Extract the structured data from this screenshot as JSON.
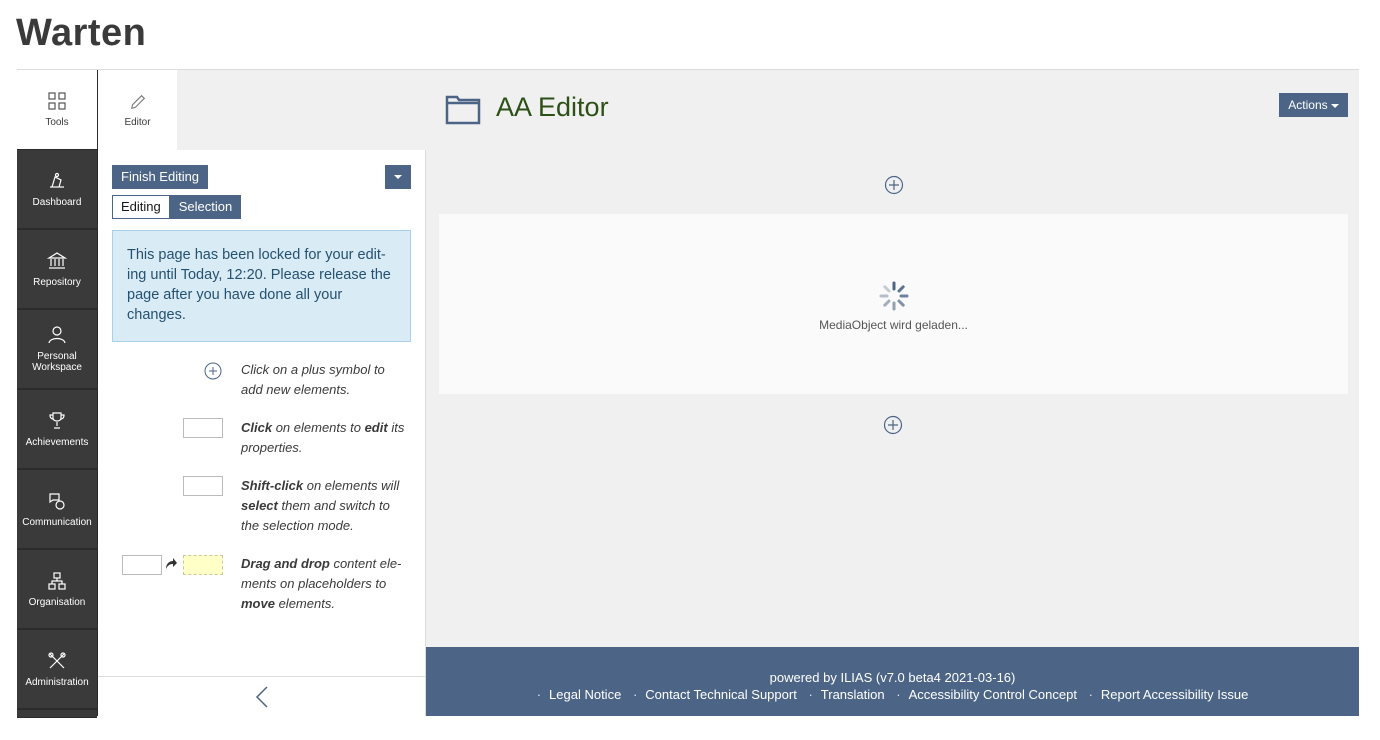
{
  "page_title": "Warten",
  "mainbar": {
    "items": [
      {
        "label": "Tools",
        "icon": "grid-icon"
      },
      {
        "label": "Dashboard",
        "icon": "dashboard-icon"
      },
      {
        "label": "Repository",
        "icon": "bank-icon"
      },
      {
        "label": "Personal Workspace",
        "icon": "user-icon"
      },
      {
        "label": "Achievements",
        "icon": "trophy-icon"
      },
      {
        "label": "Communication",
        "icon": "chat-icon"
      },
      {
        "label": "Organisation",
        "icon": "org-icon"
      },
      {
        "label": "Administration",
        "icon": "tools-icon"
      }
    ]
  },
  "slate": {
    "tab_label": "Editor",
    "finish_editing": "Finish Editing",
    "mode_editing": "Editing",
    "mode_selection": "Selection",
    "lock_message": "This page has been locked for your edit-ing until Today, 12:20. Please release the page after you have done all your changes.",
    "help": {
      "plus_a": "Click on a plus symbol to",
      "plus_b": "add new elements.",
      "click_b1": "Click",
      "click_t1": " on elements to ",
      "click_b2": "edit",
      "click_t2": " its properties.",
      "shift_b1": "Shift-click",
      "shift_t1": " on elements will ",
      "shift_b2": "select",
      "shift_t2": " them and switch to the selection mode.",
      "drag_b1": "Drag and drop",
      "drag_t1": " content ele-ments on placeholders to ",
      "drag_b2": "move",
      "drag_t2": " elements."
    }
  },
  "content": {
    "title": "AA Editor",
    "actions_label": "Actions",
    "media_loading": "MediaObject wird geladen..."
  },
  "footer": {
    "powered": "powered by ILIAS (v7.0 beta4 2021-03-16)",
    "links": [
      "Legal Notice",
      "Contact Technical Support",
      "Translation",
      "Accessibility Control Concept",
      "Report Accessibility Issue"
    ]
  },
  "colors": {
    "accent": "#4c6586",
    "mainbar_bg": "#3a3a3a",
    "title_green": "#2d5016",
    "info_bg": "#d9ebf5"
  }
}
